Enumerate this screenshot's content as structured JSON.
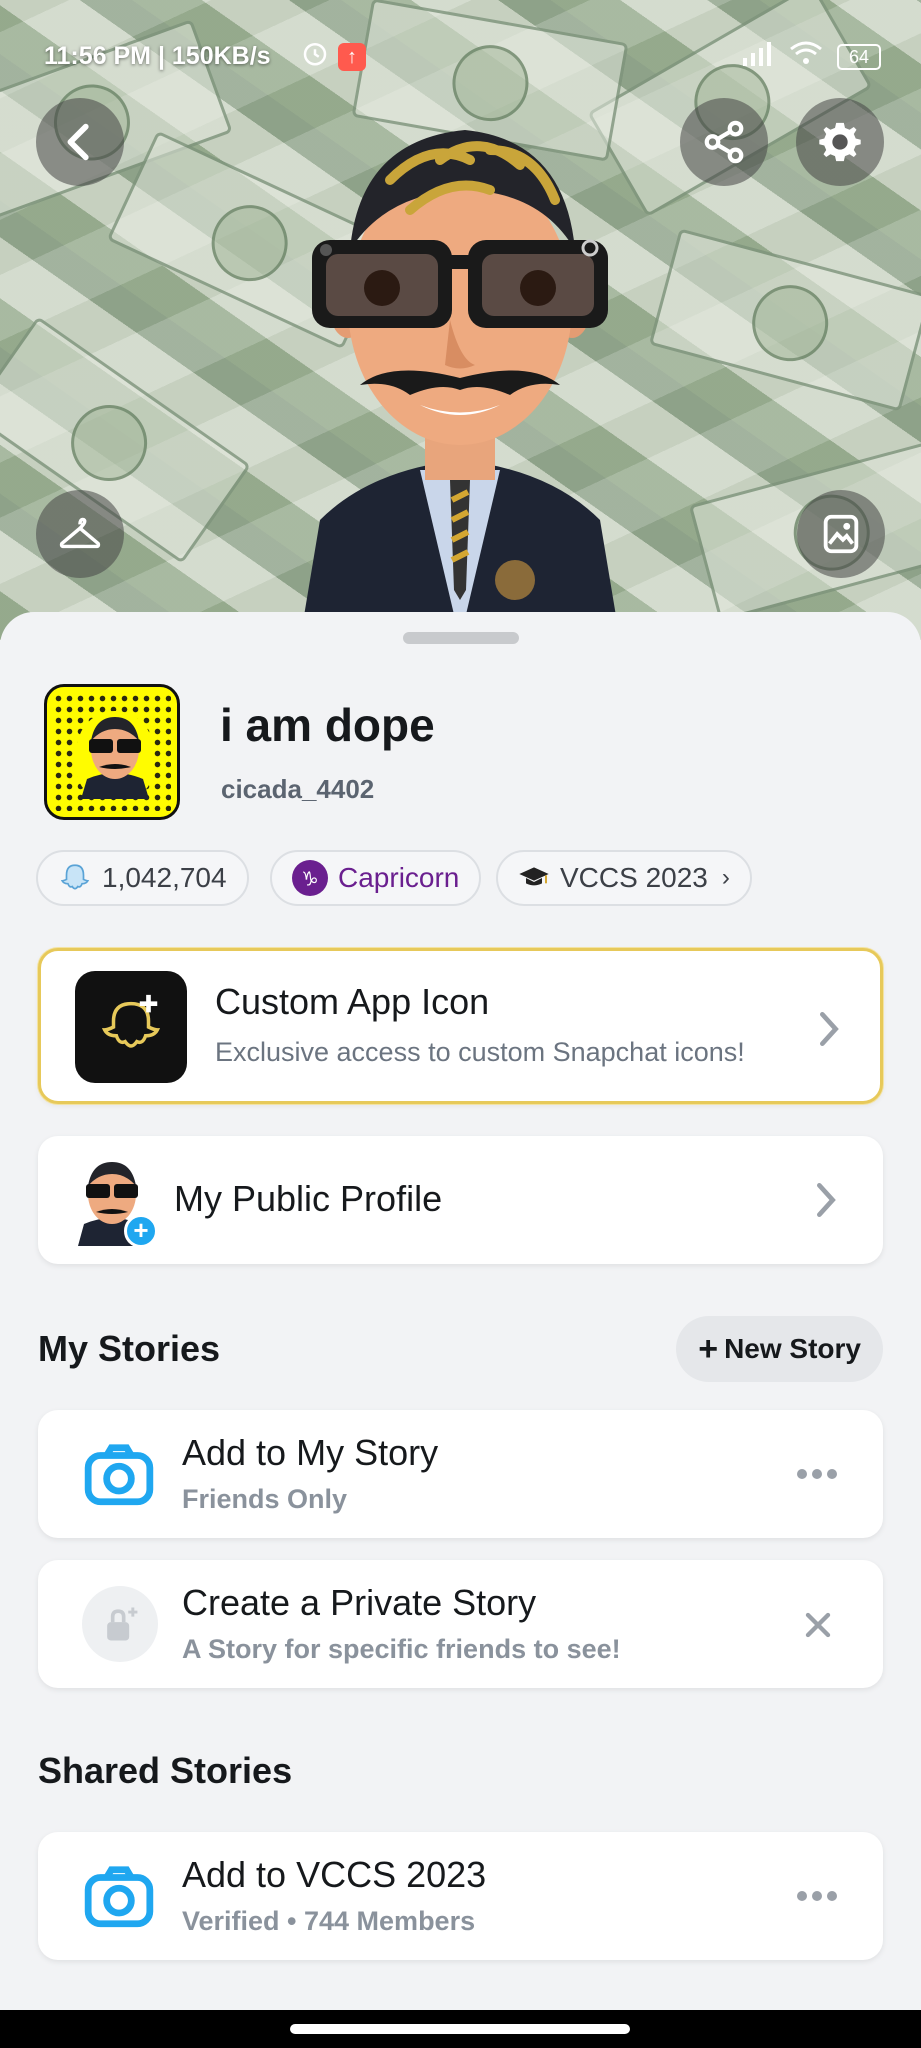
{
  "status_bar": {
    "time": "11:56 PM | 150KB/s",
    "battery": "64"
  },
  "profile": {
    "display_name": "i am dope",
    "username": "cicada_4402",
    "score": "1,042,704",
    "zodiac": "Capricorn",
    "school": "VCCS 2023"
  },
  "custom_icon_card": {
    "title": "Custom App Icon",
    "subtitle": "Exclusive access to custom Snapchat icons!"
  },
  "public_profile": {
    "title": "My Public Profile"
  },
  "my_stories": {
    "section_title": "My Stories",
    "new_story_label": "New Story",
    "items": [
      {
        "title": "Add to My Story",
        "subtitle": "Friends Only"
      },
      {
        "title": "Create a Private Story",
        "subtitle": "A Story for specific friends to see!"
      }
    ]
  },
  "shared_stories": {
    "section_title": "Shared Stories",
    "items": [
      {
        "title": "Add to VCCS 2023",
        "subtitle": "Verified • 744 Members"
      }
    ]
  },
  "colors": {
    "snap_yellow": "#fffc00",
    "accent_blue": "#1fa7f0",
    "zodiac_purple": "#6a1f8f",
    "gold_border": "#e7c95a"
  },
  "icons": [
    "back-arrow-icon",
    "share-icon",
    "settings-gear-icon",
    "hanger-icon",
    "gallery-icon",
    "ghost-icon",
    "capricorn-icon",
    "graduation-cap-icon",
    "chevron-right-icon",
    "camera-icon",
    "more-dots-icon",
    "lock-plus-icon",
    "close-x-icon",
    "plus-icon"
  ]
}
